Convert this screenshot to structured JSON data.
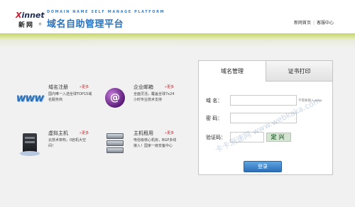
{
  "header": {
    "logo_brand_x": "X",
    "logo_brand_rest": "innet",
    "logo_cn": "新网",
    "logo_registered": "®",
    "platform_en": "DOMAIN NAME SELF MANAGE PLATFORM",
    "platform_cn": "域名自助管理平台",
    "links": [
      {
        "label": "新网首页"
      },
      {
        "label": "客服中心"
      }
    ],
    "separator": "|"
  },
  "services": [
    {
      "icon": "www-icon",
      "icon_text": "www",
      "title": "域名注册",
      "more": "更多",
      "description": "国内唯一入选全球TOP15域名服务商"
    },
    {
      "icon": "email-icon",
      "icon_text": "@",
      "title": "企业邮箱",
      "more": "更多",
      "description": "全面灵活，覆盖全球7x24小时专业技术支持"
    },
    {
      "icon": "virtual-host-icon",
      "icon_text": "",
      "title": "虚拟主机",
      "more": "更多",
      "description": "云技术架构，0宕机大空间！"
    },
    {
      "icon": "server-hosting-icon",
      "icon_text": "",
      "title": "主机租用",
      "more": "更多",
      "description": "电信级核心机房，BGP多线接入！国家一级安备中心"
    }
  ],
  "login": {
    "tabs": [
      {
        "label": "域名管理",
        "active": true
      },
      {
        "label": "证书打印",
        "active": false
      }
    ],
    "domain_label": "域    名：",
    "domain_value": "",
    "domain_hint": "不需要输入www",
    "password_label": "密    码：",
    "password_value": "",
    "captcha_label": "验证码：",
    "captcha_value": "",
    "captcha_image_text": "定兴",
    "submit_label": "登录"
  },
  "watermark": "卡卡测速网 www.webkaka.com",
  "colors": {
    "brand_blue": "#2a73bf",
    "more_red": "#c8262c",
    "header_accent": "#c6d66a",
    "button_blue": "#2c6fb8"
  }
}
